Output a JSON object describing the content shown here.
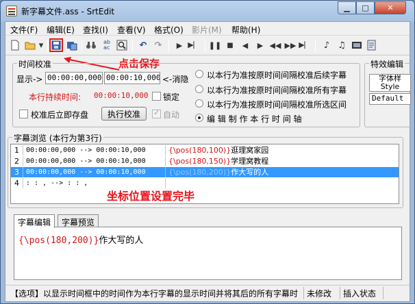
{
  "window": {
    "title": "新字幕文件.ass - SrtEdit"
  },
  "menu": [
    "文件(F)",
    "编辑(E)",
    "查找(I)",
    "查看(V)",
    "格式(O)",
    "影片(M)",
    "帮助(H)"
  ],
  "annotations": {
    "save": "点击保存",
    "done": "坐标位置设置完毕"
  },
  "timing": {
    "group_label": "时间校准",
    "display_label": "显示->",
    "start_time": "00:00:00,000",
    "end_time": "00:00:10,000",
    "eliminate_label": "<-消隐",
    "duration_label": "本行持续时间:",
    "duration_value": "00:00:10,000",
    "lock_label": "锁定",
    "autosave_label": "校准后立即存盘",
    "calibrate_button": "执行校准",
    "auto_label": "自动",
    "radios": [
      "以本行为准按原时间间隔校准后续字幕",
      "以本行为准按原时间间隔校准所有字幕",
      "以本行为准按原时间间隔校准所选区间",
      "编 辑 制 作 本 行 时 间 轴"
    ],
    "radio_selected_index": 3
  },
  "effects": {
    "group_label": "特效编辑",
    "font_label": "字体样",
    "style_label": "Style",
    "style_value": "Default"
  },
  "subtitle_list": {
    "group_label": "字幕浏览 (本行为第3行)",
    "rows": [
      {
        "num": "1",
        "time": "00:00:00,000 --> 00:00:10,000",
        "tag": "{\\pos(180,100)}",
        "text": "逛理窝家园"
      },
      {
        "num": "2",
        "time": "00:00:00,000 --> 00:00:10,000",
        "tag": "{\\pos(180,150)}",
        "text": "学理窝教程"
      },
      {
        "num": "3",
        "time": "00:00:00,000 --> 00:00:10,000",
        "tag": "{\\pos(180,200)}",
        "text": "作大写的人"
      },
      {
        "num": "4",
        "time": "  :  :  ,    -->   :  :  ,",
        "tag": "",
        "text": ""
      }
    ],
    "selected_row_index": 2
  },
  "editor": {
    "tabs": [
      "字幕编辑",
      "字幕预览"
    ],
    "active_tab_index": 0,
    "tag": "{\\pos(180,200)}",
    "body": "作大写的人"
  },
  "status": {
    "hint": "【选项】以显示时间框中的时间作为本行字幕的显示时间并将其后的所有字幕时",
    "modified": "未修改",
    "mode": "插入状态"
  },
  "colors": {
    "annotation": "#e8141b",
    "selection": "#3399ff",
    "tag": "#d41414"
  }
}
